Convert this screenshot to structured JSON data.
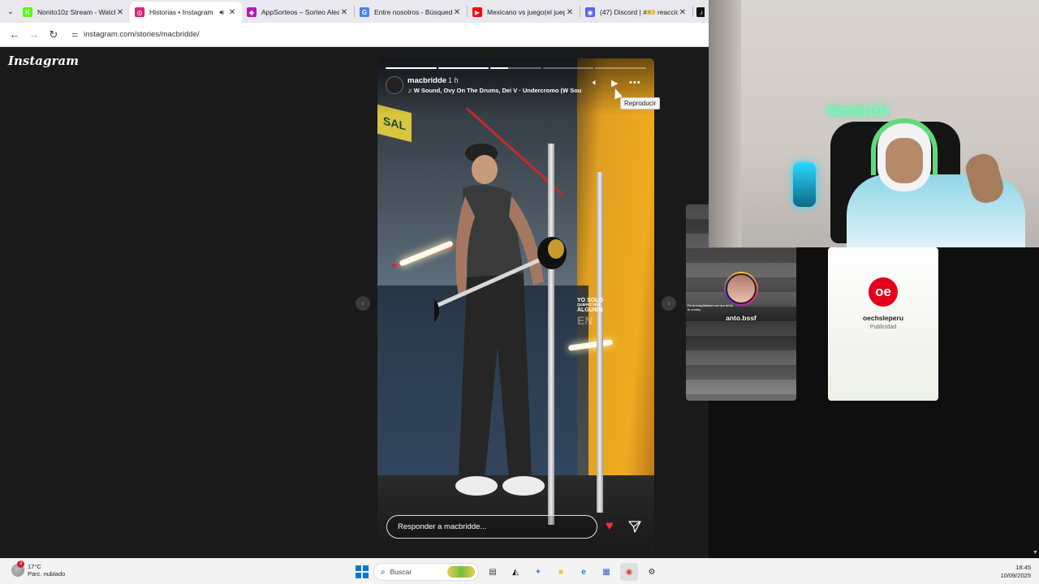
{
  "browser": {
    "tabs": [
      {
        "title": "Nonito10z Stream - Watch",
        "favicon": "kick-icon",
        "color": "#53fc18",
        "glyph": "K",
        "active": false
      },
      {
        "title": "Historias • Instagram",
        "favicon": "instagram-icon",
        "color": "#d62976",
        "glyph": "◎",
        "active": true,
        "audio": true
      },
      {
        "title": "AppSorteos – Sorteo Alea",
        "favicon": "appsorteos-icon",
        "color": "#b01cba",
        "glyph": "◆",
        "active": false
      },
      {
        "title": "Entre nosotros - Búsqued",
        "favicon": "google-icon",
        "color": "#4285f4",
        "glyph": "G",
        "active": false
      },
      {
        "title": "Mexicano vs juego(el jueg",
        "favicon": "youtube-icon",
        "color": "#ff0000",
        "glyph": "▶",
        "active": false
      },
      {
        "title": "(47) Discord | #🎫 reacció",
        "favicon": "discord-icon",
        "color": "#5865f2",
        "glyph": "◉",
        "active": false
      }
    ],
    "extra_tab_icon": "tiktok-icon",
    "url": "instagram.com/stories/macbridde/"
  },
  "instagram": {
    "logo": "Instagram",
    "story": {
      "username": "macbridde",
      "time_ago": "1 h",
      "music": "♫ W Sound, Ovy On The Drums, Dei V · Undercromo (W Sou",
      "progress_segments": [
        1,
        1,
        0.35,
        0,
        0
      ],
      "tooltip": "Reproducir",
      "overlay_line1": "YO SOLO",
      "overlay_line2": "QUIERO SER",
      "overlay_line3": "ALGUIEN",
      "overlay_ghost": "EN",
      "sign_text": "SAL",
      "reply_placeholder": "Responder a macbridde..."
    },
    "next_story": {
      "username": "anto.bssf",
      "caption": "Pa la hospitalidad con sur de la fe sonbly"
    },
    "ad_story": {
      "username": "oechsleperu",
      "label": "Publicidad",
      "logo_text": "oe"
    }
  },
  "webcam": {
    "neon_sign": "Nonito10z"
  },
  "taskbar": {
    "weather_temp": "17°C",
    "weather_desc": "Parc. nublado",
    "weather_badge": "3",
    "search_placeholder": "Buscar",
    "time": "18:45",
    "date": "10/09/2025",
    "apps": [
      {
        "name": "file-manager-icon",
        "color": "#3b3b3b",
        "glyph": "▤"
      },
      {
        "name": "capcut-icon",
        "color": "#1a1a1a",
        "glyph": "◭"
      },
      {
        "name": "copilot-icon",
        "color": "#5b7cfa",
        "glyph": "✦"
      },
      {
        "name": "folder-icon",
        "color": "#f4c430",
        "glyph": "■"
      },
      {
        "name": "edge-icon",
        "color": "#0c8fd6",
        "glyph": "e"
      },
      {
        "name": "store-icon",
        "color": "#2a5fd6",
        "glyph": "▦"
      },
      {
        "name": "chrome-icon",
        "color": "#e84335",
        "glyph": "◉"
      },
      {
        "name": "steam-icon",
        "color": "#1b2838",
        "glyph": "⚙"
      }
    ]
  }
}
